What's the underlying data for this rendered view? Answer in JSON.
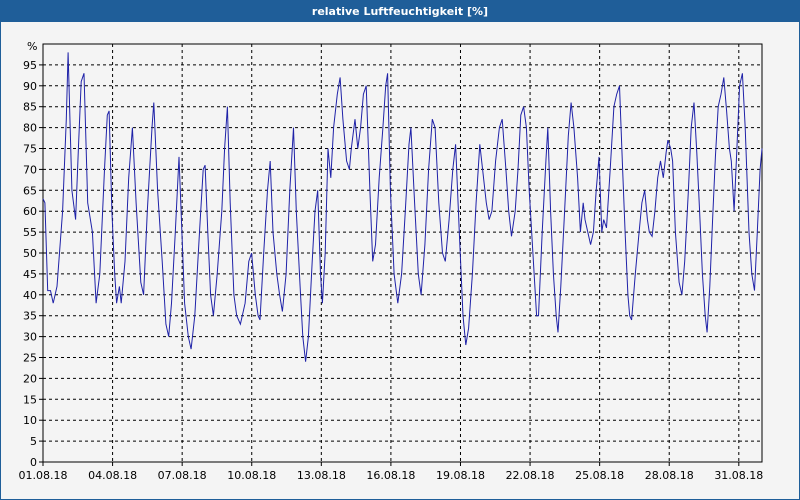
{
  "window": {
    "title": "relative Luftfeuchtigkeit [%]"
  },
  "chart_data": {
    "type": "line",
    "title": "relative Luftfeuchtigkeit [%]",
    "ylabel": "%",
    "ylim": [
      0,
      100
    ],
    "yticks": [
      0,
      5,
      10,
      15,
      20,
      25,
      30,
      35,
      40,
      45,
      50,
      55,
      60,
      65,
      70,
      75,
      80,
      85,
      90,
      95
    ],
    "xlim": [
      "01.08.18",
      "01.09.18"
    ],
    "xtick_labels": [
      "01.08.18",
      "04.08.18",
      "07.08.18",
      "10.08.18",
      "13.08.18",
      "16.08.18",
      "19.08.18",
      "22.08.18",
      "25.08.18",
      "28.08.18",
      "31.08.18"
    ],
    "grid": true,
    "color": "#1f22a8",
    "series": [
      {
        "x_unit": "days since 01.08.18 00:00",
        "points": [
          [
            0.0,
            63
          ],
          [
            0.1,
            62
          ],
          [
            0.25,
            41
          ],
          [
            0.4,
            41
          ],
          [
            0.55,
            38
          ],
          [
            0.75,
            42
          ],
          [
            1.05,
            60
          ],
          [
            1.25,
            82
          ],
          [
            1.35,
            98
          ],
          [
            1.55,
            65
          ],
          [
            1.75,
            58
          ],
          [
            1.9,
            75
          ],
          [
            2.05,
            91
          ],
          [
            2.2,
            93
          ],
          [
            2.4,
            62
          ],
          [
            2.65,
            55
          ],
          [
            2.85,
            38
          ],
          [
            3.05,
            45
          ],
          [
            3.3,
            70
          ],
          [
            3.45,
            83
          ],
          [
            3.55,
            84
          ],
          [
            3.7,
            60
          ],
          [
            3.85,
            45
          ],
          [
            3.95,
            38
          ],
          [
            4.1,
            42
          ],
          [
            4.2,
            38
          ],
          [
            4.4,
            48
          ],
          [
            4.6,
            68
          ],
          [
            4.8,
            80
          ],
          [
            5.0,
            62
          ],
          [
            5.25,
            43
          ],
          [
            5.4,
            40
          ],
          [
            5.6,
            60
          ],
          [
            5.85,
            80
          ],
          [
            5.95,
            86
          ],
          [
            6.15,
            65
          ],
          [
            6.4,
            48
          ],
          [
            6.6,
            33
          ],
          [
            6.75,
            30
          ],
          [
            6.9,
            38
          ],
          [
            7.1,
            55
          ],
          [
            7.3,
            73
          ],
          [
            7.5,
            50
          ],
          [
            7.6,
            38
          ],
          [
            7.8,
            30
          ],
          [
            7.95,
            27
          ],
          [
            8.15,
            35
          ],
          [
            8.4,
            55
          ],
          [
            8.6,
            70
          ],
          [
            8.7,
            71
          ],
          [
            8.85,
            55
          ],
          [
            9.0,
            40
          ],
          [
            9.15,
            35
          ],
          [
            9.35,
            45
          ],
          [
            9.6,
            60
          ],
          [
            9.75,
            75
          ],
          [
            9.9,
            85
          ],
          [
            10.05,
            62
          ],
          [
            10.25,
            40
          ],
          [
            10.4,
            35
          ],
          [
            10.6,
            33
          ],
          [
            10.85,
            38
          ],
          [
            11.05,
            48
          ],
          [
            11.2,
            50
          ],
          [
            11.4,
            40
          ],
          [
            11.55,
            35
          ],
          [
            11.65,
            34
          ],
          [
            11.85,
            50
          ],
          [
            12.05,
            65
          ],
          [
            12.2,
            72
          ],
          [
            12.35,
            55
          ],
          [
            12.55,
            45
          ],
          [
            12.7,
            40
          ],
          [
            12.85,
            36
          ],
          [
            13.05,
            45
          ],
          [
            13.25,
            65
          ],
          [
            13.45,
            80
          ],
          [
            13.6,
            60
          ],
          [
            13.8,
            42
          ],
          [
            13.95,
            30
          ],
          [
            14.1,
            24
          ],
          [
            14.25,
            30
          ],
          [
            14.45,
            48
          ],
          [
            14.6,
            60
          ],
          [
            14.75,
            65
          ],
          [
            14.9,
            45
          ],
          [
            15.0,
            38
          ],
          [
            15.15,
            50
          ],
          [
            15.3,
            75
          ],
          [
            15.45,
            68
          ],
          [
            15.6,
            80
          ],
          [
            15.8,
            88
          ],
          [
            15.95,
            92
          ],
          [
            16.1,
            82
          ],
          [
            16.3,
            72
          ],
          [
            16.45,
            70
          ],
          [
            16.55,
            75
          ],
          [
            16.75,
            82
          ],
          [
            16.9,
            75
          ],
          [
            17.05,
            80
          ],
          [
            17.2,
            88
          ],
          [
            17.35,
            90
          ],
          [
            17.55,
            65
          ],
          [
            17.7,
            48
          ],
          [
            17.85,
            52
          ],
          [
            18.05,
            68
          ],
          [
            18.25,
            80
          ],
          [
            18.4,
            90
          ],
          [
            18.5,
            93
          ],
          [
            18.65,
            65
          ],
          [
            18.85,
            45
          ],
          [
            19.05,
            38
          ],
          [
            19.25,
            45
          ],
          [
            19.45,
            60
          ],
          [
            19.65,
            76
          ],
          [
            19.75,
            80
          ],
          [
            19.95,
            62
          ],
          [
            20.15,
            45
          ],
          [
            20.3,
            40
          ],
          [
            20.5,
            52
          ],
          [
            20.7,
            70
          ],
          [
            20.9,
            82
          ],
          [
            21.05,
            80
          ],
          [
            21.25,
            62
          ],
          [
            21.45,
            50
          ],
          [
            21.6,
            48
          ],
          [
            21.8,
            58
          ],
          [
            22.0,
            70
          ],
          [
            22.15,
            76
          ],
          [
            22.35,
            55
          ],
          [
            22.55,
            35
          ],
          [
            22.7,
            28
          ],
          [
            22.85,
            32
          ],
          [
            23.05,
            45
          ],
          [
            23.25,
            62
          ],
          [
            23.45,
            76
          ],
          [
            23.6,
            70
          ],
          [
            23.8,
            62
          ],
          [
            23.95,
            58
          ],
          [
            24.1,
            60
          ],
          [
            24.3,
            72
          ],
          [
            24.5,
            80
          ],
          [
            24.65,
            82
          ],
          [
            24.85,
            70
          ],
          [
            25.0,
            60
          ],
          [
            25.15,
            54
          ],
          [
            25.35,
            60
          ],
          [
            25.5,
            70
          ],
          [
            25.65,
            83
          ],
          [
            25.8,
            85
          ],
          [
            25.95,
            80
          ],
          [
            26.1,
            65
          ],
          [
            26.3,
            50
          ],
          [
            26.5,
            35
          ],
          [
            26.6,
            35
          ],
          [
            26.8,
            55
          ],
          [
            27.0,
            72
          ],
          [
            27.1,
            80
          ],
          [
            27.25,
            60
          ],
          [
            27.4,
            45
          ],
          [
            27.55,
            35
          ],
          [
            27.65,
            31
          ],
          [
            27.8,
            42
          ],
          [
            28.0,
            60
          ],
          [
            28.2,
            78
          ],
          [
            28.35,
            86
          ],
          [
            28.5,
            80
          ],
          [
            28.7,
            68
          ],
          [
            28.85,
            55
          ],
          [
            29.0,
            62
          ],
          [
            29.1,
            58
          ],
          [
            29.25,
            55
          ],
          [
            29.4,
            52
          ],
          [
            29.55,
            55
          ],
          [
            29.7,
            65
          ],
          [
            29.85,
            73
          ],
          [
            30.0,
            55
          ],
          [
            30.1,
            58
          ],
          [
            30.25,
            56
          ],
          [
            30.45,
            70
          ],
          [
            30.65,
            85
          ],
          [
            30.8,
            88
          ],
          [
            30.95,
            90
          ],
          [
            31.1,
            72
          ],
          [
            31.25,
            55
          ],
          [
            31.4,
            40
          ],
          [
            31.5,
            35
          ],
          [
            31.6,
            34
          ],
          [
            31.8,
            45
          ],
          [
            32.0,
            55
          ],
          [
            32.15,
            62
          ],
          [
            32.3,
            65
          ],
          [
            32.45,
            58
          ],
          [
            32.55,
            55
          ],
          [
            32.7,
            54
          ],
          [
            32.85,
            60
          ],
          [
            33.0,
            68
          ],
          [
            33.15,
            72
          ],
          [
            33.3,
            68
          ],
          [
            33.45,
            74
          ],
          [
            33.55,
            77
          ],
          [
            33.7,
            75
          ],
          [
            33.8,
            72
          ],
          [
            33.95,
            55
          ],
          [
            34.15,
            43
          ],
          [
            34.3,
            40
          ],
          [
            34.45,
            48
          ],
          [
            34.65,
            65
          ],
          [
            34.8,
            80
          ],
          [
            34.95,
            86
          ],
          [
            35.1,
            74
          ],
          [
            35.25,
            60
          ],
          [
            35.4,
            45
          ],
          [
            35.55,
            35
          ],
          [
            35.65,
            31
          ],
          [
            35.8,
            42
          ],
          [
            35.95,
            58
          ],
          [
            36.1,
            73
          ],
          [
            36.25,
            85
          ],
          [
            36.4,
            88
          ],
          [
            36.55,
            92
          ],
          [
            36.7,
            84
          ],
          [
            36.85,
            75
          ],
          [
            36.95,
            72
          ],
          [
            37.1,
            60
          ],
          [
            37.25,
            75
          ],
          [
            37.4,
            90
          ],
          [
            37.55,
            93
          ],
          [
            37.7,
            80
          ],
          [
            37.9,
            55
          ],
          [
            38.05,
            45
          ],
          [
            38.2,
            41
          ],
          [
            38.35,
            55
          ],
          [
            38.5,
            70
          ],
          [
            38.6,
            75
          ]
        ]
      }
    ]
  }
}
